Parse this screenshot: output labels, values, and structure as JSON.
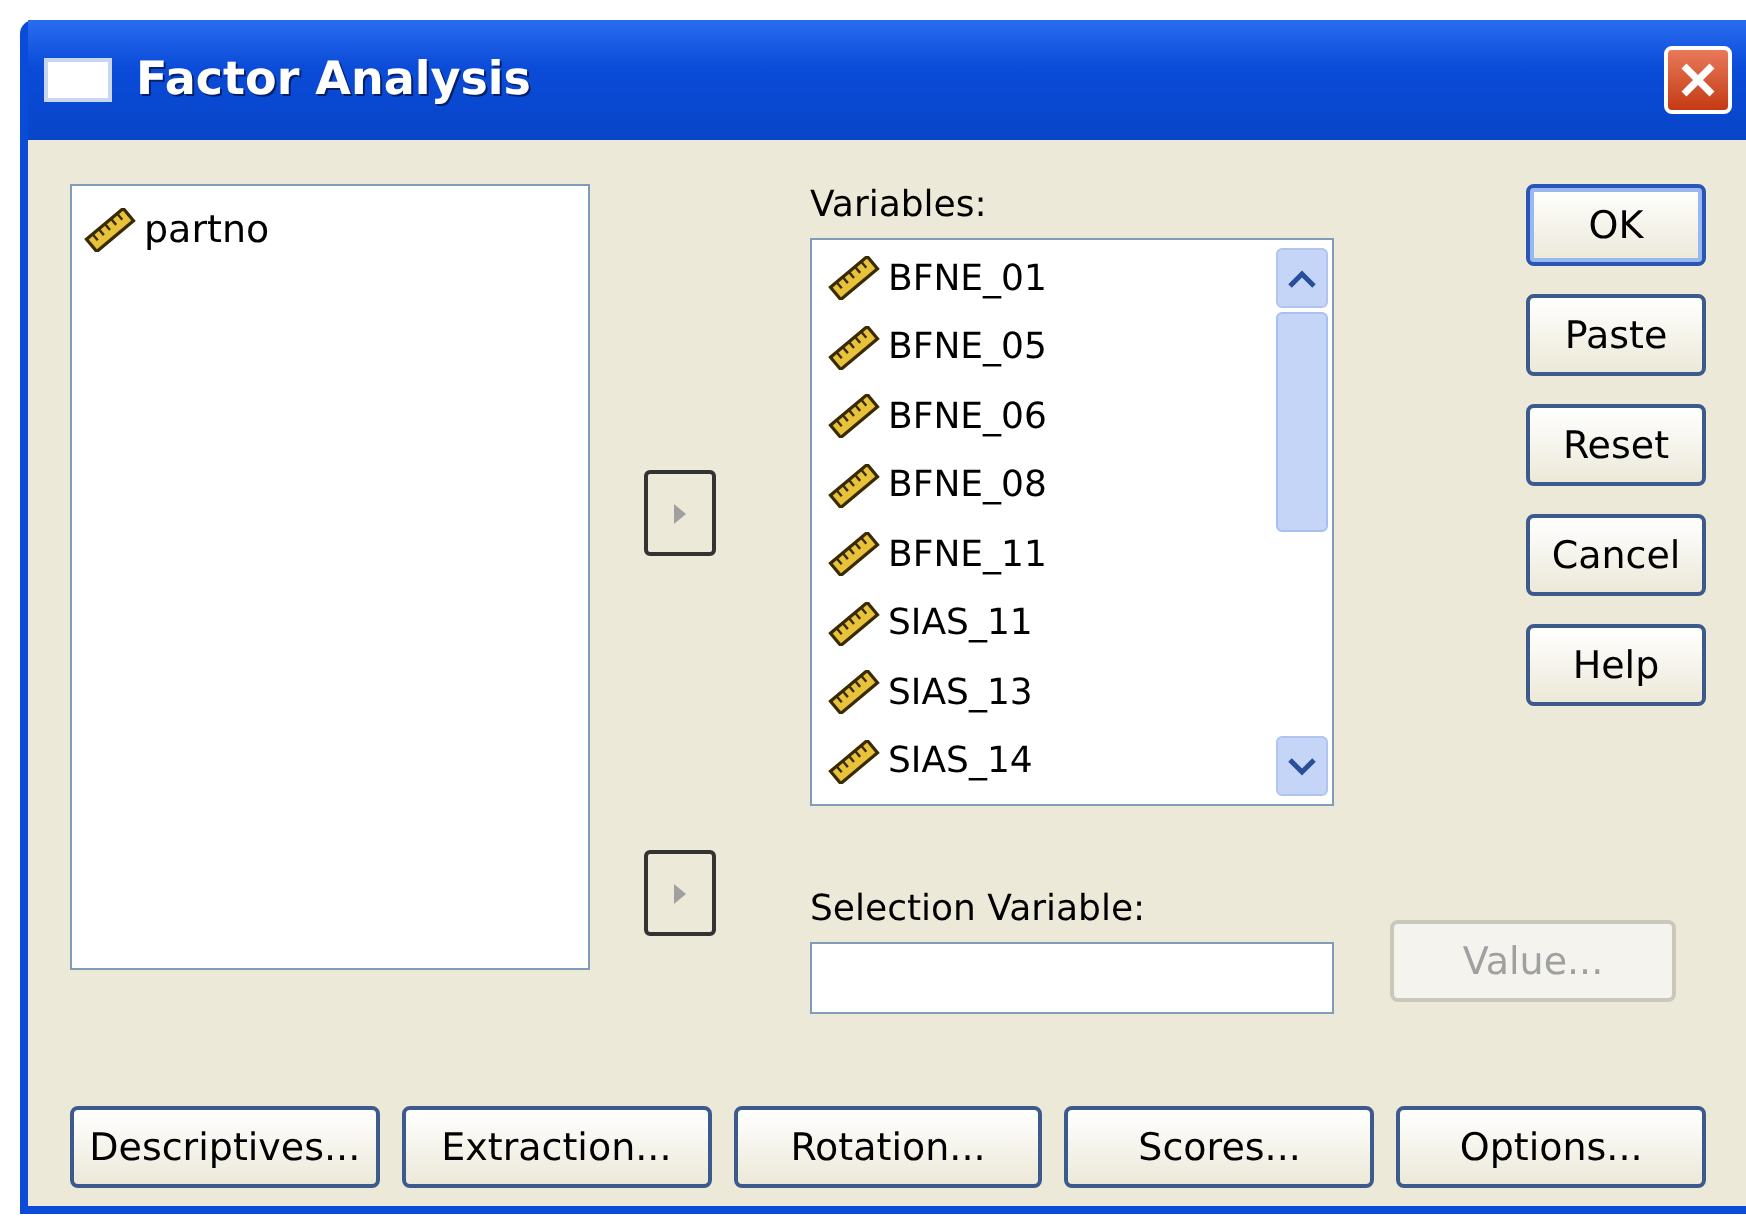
{
  "window": {
    "title": "Factor Analysis"
  },
  "source_list": {
    "items": [
      {
        "label": "partno",
        "kind": "scale"
      }
    ]
  },
  "variables": {
    "label": "Variables:",
    "items": [
      {
        "label": "BFNE_01",
        "kind": "scale"
      },
      {
        "label": "BFNE_05",
        "kind": "scale"
      },
      {
        "label": "BFNE_06",
        "kind": "scale"
      },
      {
        "label": "BFNE_08",
        "kind": "scale"
      },
      {
        "label": "BFNE_11",
        "kind": "scale"
      },
      {
        "label": "SIAS_11",
        "kind": "scale"
      },
      {
        "label": "SIAS_13",
        "kind": "scale"
      },
      {
        "label": "SIAS_14",
        "kind": "scale"
      }
    ]
  },
  "selection_variable": {
    "label": "Selection Variable:"
  },
  "value_button": {
    "label": "Value...",
    "disabled": true
  },
  "side_buttons": [
    {
      "label": "OK",
      "default": true
    },
    {
      "label": "Paste",
      "default": false
    },
    {
      "label": "Reset",
      "default": false
    },
    {
      "label": "Cancel",
      "default": false
    },
    {
      "label": "Help",
      "default": false
    }
  ],
  "bottom_buttons": [
    {
      "label": "Descriptives..."
    },
    {
      "label": "Extraction..."
    },
    {
      "label": "Rotation..."
    },
    {
      "label": "Scores..."
    },
    {
      "label": "Options..."
    }
  ]
}
